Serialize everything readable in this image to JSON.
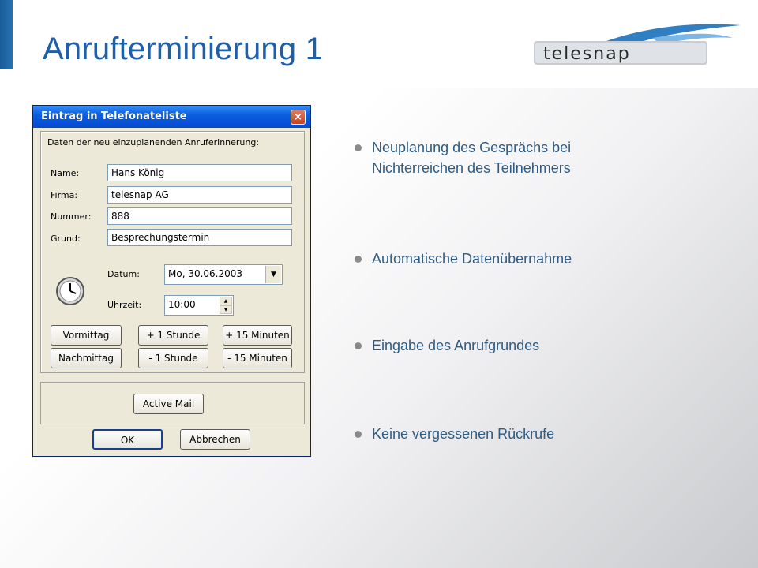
{
  "slide": {
    "title": "Anrufterminierung 1",
    "logo_text": "telesnap"
  },
  "dialog": {
    "title": "Eintrag in Telefonateliste",
    "close_icon": "×",
    "group_caption": "Daten der neu einzuplanenden Anruferinnerung:",
    "fields": [
      {
        "label": "Name:",
        "value": "Hans König"
      },
      {
        "label": "Firma:",
        "value": "telesnap AG"
      },
      {
        "label": "Nummer:",
        "value": "888"
      },
      {
        "label": "Grund:",
        "value": "Besprechungstermin"
      }
    ],
    "datum_label": "Datum:",
    "datum_value": "Mo, 30.06.2003",
    "uhrzeit_label": "Uhrzeit:",
    "uhrzeit_value": "10:00",
    "buttons": {
      "vormittag": "Vormittag",
      "plus_stunde": "+ 1 Stunde",
      "plus_15": "+ 15 Minuten",
      "nachmittag": "Nachmittag",
      "minus_stunde": "- 1 Stunde",
      "minus_15": "- 15 Minuten",
      "active_mail": "Active Mail",
      "ok": "OK",
      "abbrechen": "Abbrechen"
    }
  },
  "bullets": [
    "Neuplanung des Gesprächs bei Nichterreichen des Teilnehmers",
    "Automatische Datenübernahme",
    "Eingabe des Anrufgrundes",
    "Keine vergessenen Rückrufe"
  ],
  "colors": {
    "title": "#1f5fa8",
    "bullet_text": "#2e5c85",
    "accent": "#1b5d9a"
  }
}
